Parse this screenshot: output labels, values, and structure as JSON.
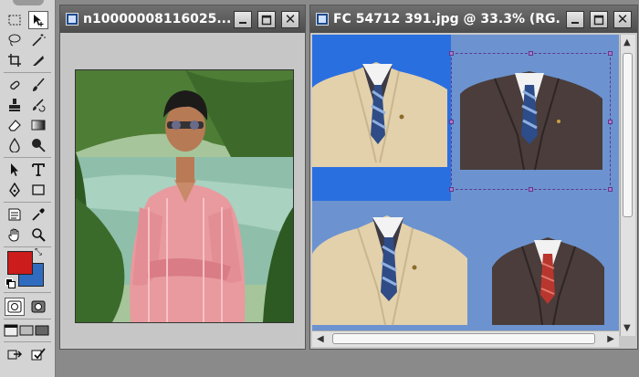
{
  "tools_panel": {
    "tools": [
      {
        "name": "rect-marquee-tool",
        "glyph": "⬚"
      },
      {
        "name": "move-tool",
        "glyph": "✥",
        "selected": true
      },
      {
        "name": "lasso-tool",
        "glyph": "ʘ"
      },
      {
        "name": "magic-wand-tool",
        "glyph": "⚚"
      },
      {
        "name": "crop-tool",
        "glyph": "⌗"
      },
      {
        "name": "eyedropper-slice-tool",
        "glyph": "✎"
      },
      {
        "name": "healing-brush-tool",
        "glyph": "✚"
      },
      {
        "name": "brush-tool",
        "glyph": "🖌"
      },
      {
        "name": "clone-stamp-tool",
        "glyph": "⛀"
      },
      {
        "name": "history-brush-tool",
        "glyph": "✐"
      },
      {
        "name": "eraser-tool",
        "glyph": "⌫"
      },
      {
        "name": "gradient-tool",
        "glyph": "■"
      },
      {
        "name": "blur-tool",
        "glyph": "💧"
      },
      {
        "name": "dodge-tool",
        "glyph": "●"
      },
      {
        "name": "path-selection-tool",
        "glyph": "➤"
      },
      {
        "name": "type-tool",
        "glyph": "T"
      },
      {
        "name": "pen-tool",
        "glyph": "✒"
      },
      {
        "name": "shape-tool",
        "glyph": "▭"
      },
      {
        "name": "notes-tool",
        "glyph": "▤"
      },
      {
        "name": "eyedropper-tool",
        "glyph": "✑"
      },
      {
        "name": "hand-tool",
        "glyph": "✋"
      },
      {
        "name": "zoom-tool",
        "glyph": "🔍"
      }
    ],
    "foreground_color": "#cc1c1c",
    "background_color": "#2f6cc0"
  },
  "window1": {
    "title": "n10000008116025...",
    "minimize_label": "",
    "maximize_label": "",
    "close_label": "✕"
  },
  "window2": {
    "title": "FC  54712 391.jpg @ 33.3% (RG...",
    "close_label": "✕"
  },
  "colors": {
    "title_bar": "#5a5a5a",
    "canvas_blue": "#6c93cf",
    "selection_blue": "#2a6fe0",
    "workspace": "#8a8a8a"
  }
}
